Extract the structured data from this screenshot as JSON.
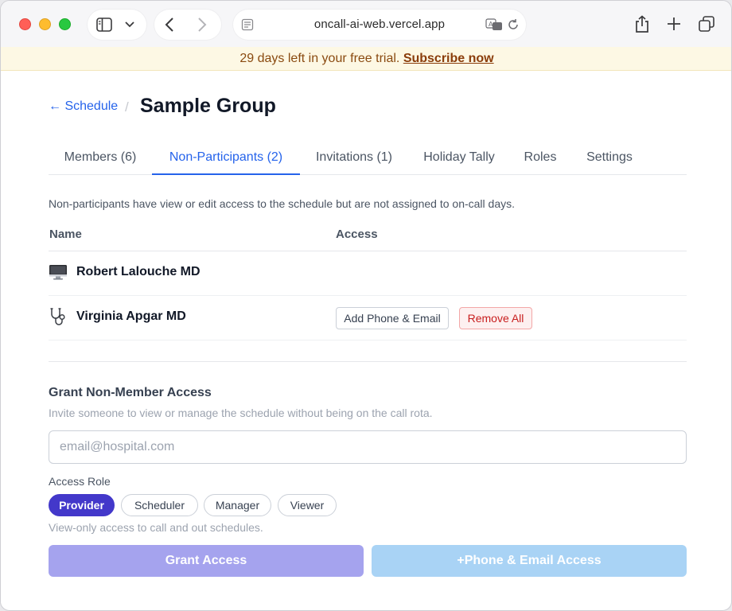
{
  "browser": {
    "url": "oncall-ai-web.vercel.app"
  },
  "banner": {
    "text": "29 days left in your free trial.",
    "link": "Subscribe now"
  },
  "header": {
    "back_link": "← Schedule",
    "separator": "/",
    "title": "Sample Group"
  },
  "tabs": [
    {
      "label": "Members (6)",
      "active": false
    },
    {
      "label": "Non-Participants (2)",
      "active": true
    },
    {
      "label": "Invitations (1)",
      "active": false
    },
    {
      "label": "Holiday Tally",
      "active": false
    },
    {
      "label": "Roles",
      "active": false
    },
    {
      "label": "Settings",
      "active": false
    }
  ],
  "description": "Non-participants have view or edit access to the schedule but are not assigned to on-call days.",
  "table": {
    "columns": [
      "Name",
      "Access"
    ],
    "rows": [
      {
        "icon": "computer-icon",
        "name": "Robert Lalouche MD",
        "actions": []
      },
      {
        "icon": "stethoscope-icon",
        "name": "Virginia Apgar MD",
        "actions": [
          "Add Phone & Email",
          "Remove All"
        ]
      }
    ]
  },
  "grant": {
    "title": "Grant Non-Member Access",
    "subtitle": "Invite someone to view or manage the schedule without being on the call rota.",
    "email_placeholder": "email@hospital.com",
    "email_value": "",
    "role_label": "Access Role",
    "roles": [
      "Provider",
      "Scheduler",
      "Manager",
      "Viewer"
    ],
    "selected_role": "Provider",
    "role_help": "View-only access to call and out schedules.",
    "grant_button": "Grant Access",
    "phone_button": "+Phone & Email Access"
  },
  "colors": {
    "accent": "#2563eb",
    "selected_chip": "#4338ca",
    "danger": "#c81e1e",
    "banner_bg": "#fdf8e4"
  }
}
